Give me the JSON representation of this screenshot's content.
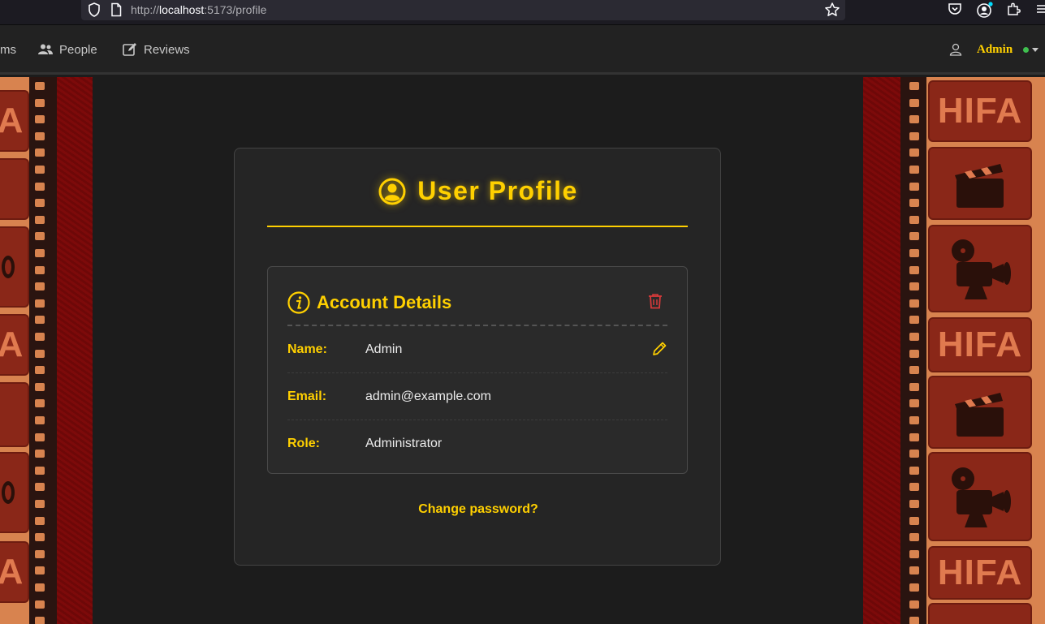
{
  "browser": {
    "url_prefix": "http://",
    "url_host": "localhost",
    "url_path": ":5173/profile"
  },
  "navbar": {
    "partial_item": "ms",
    "items": [
      {
        "label": "People",
        "icon": "people-icon"
      },
      {
        "label": "Reviews",
        "icon": "edit-icon"
      }
    ],
    "user": {
      "name": "Admin",
      "status_color": "#3fbf4f"
    }
  },
  "film_strip": {
    "tile_text": "HIFA",
    "partial_tile_text": "A"
  },
  "profile": {
    "title": "User Profile",
    "section_title": "Account Details",
    "fields": [
      {
        "label": "Name:",
        "value": "Admin"
      },
      {
        "label": "Email:",
        "value": "admin@example.com"
      },
      {
        "label": "Role:",
        "value": "Administrator"
      }
    ],
    "change_password": "Change password?"
  },
  "colors": {
    "accent": "#ffd000",
    "danger": "#d63a3a",
    "card_bg": "#252525",
    "page_bg": "#1c1c1c"
  }
}
